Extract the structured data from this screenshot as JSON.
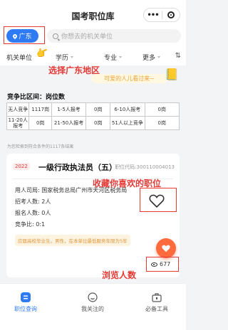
{
  "app": {
    "title": "国考职位库",
    "capsule_more": "•••"
  },
  "search": {
    "region_label": "广东",
    "placeholder": "你想去的机关单位"
  },
  "filters": [
    {
      "label": "机关单位"
    },
    {
      "label": "学历"
    },
    {
      "label": "专业"
    },
    {
      "label": "更多"
    }
  ],
  "annotations": {
    "region": "选择广东地区",
    "favorite": "收藏你喜欢的职位",
    "views": "浏览人数"
  },
  "tip": {
    "text": "可爱的人儿看过来~"
  },
  "ratio": {
    "title": "竞争比区间：岗位数",
    "rows": [
      [
        "无人竞争",
        "1117岗",
        "1-5人报考",
        "0岗",
        "6-10人报考",
        "0岗"
      ],
      [
        "11-20人报考",
        "0岗",
        "21-50人报考",
        "0岗",
        "51人以上竞争",
        "0岗"
      ]
    ],
    "count_note": "为您检索到符合条件的1117条结果"
  },
  "job": {
    "year": "2022",
    "title": "一级行政执法员（五）",
    "code": "职位代码:300110004013",
    "department": "用人司局: 国家税务总局广州市天河区税务局",
    "recruit": "招考人数: 2人",
    "applied": "报名人数: 0人",
    "ratio": "竞争比: 0:1",
    "requirement": "应届高校毕业生，男性，在本单位最低服务年限为5年",
    "views": "677"
  },
  "tabbar": [
    {
      "label": "职位查询",
      "active": true
    },
    {
      "label": "我关注的",
      "active": false
    },
    {
      "label": "必备工具",
      "active": false
    }
  ],
  "colors": {
    "accent": "#2f7bf4",
    "annotation": "#e53935",
    "fab": "#ff6b3d"
  }
}
